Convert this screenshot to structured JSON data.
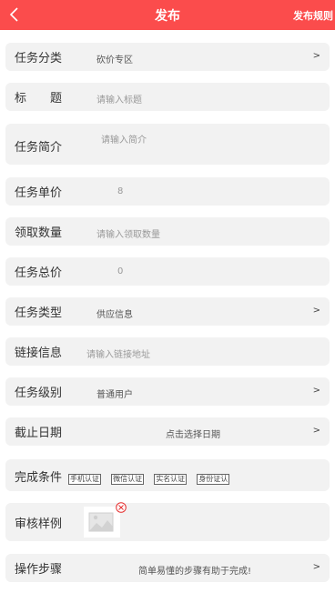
{
  "header": {
    "title": "发布",
    "rules_label": "发布规则"
  },
  "form": {
    "category": {
      "label": "任务分类",
      "value": "砍价专区",
      "arrow": ">"
    },
    "title": {
      "label": "标　　题",
      "placeholder": "请输入标题"
    },
    "intro": {
      "label": "任务简介",
      "placeholder": "请输入简介"
    },
    "unit_price": {
      "label": "任务单价",
      "value": "8"
    },
    "quantity": {
      "label": "领取数量",
      "placeholder": "请输入领取数量"
    },
    "total_price": {
      "label": "任务总价",
      "value": "0"
    },
    "type": {
      "label": "任务类型",
      "value": "供应信息",
      "arrow": ">"
    },
    "link": {
      "label": "链接信息",
      "placeholder": "请输入链接地址"
    },
    "level": {
      "label": "任务级别",
      "value": "普通用户",
      "arrow": ">"
    },
    "deadline": {
      "label": "截止日期",
      "value": "点击选择日期",
      "arrow": ">"
    },
    "conditions": {
      "label": "完成条件",
      "badges": [
        "手机认证",
        "微信认证",
        "实名认证",
        "身份证认"
      ]
    },
    "sample": {
      "label": "审核样例"
    },
    "steps": {
      "label": "操作步骤",
      "value": "简单易懂的步骤有助于完成!",
      "arrow": ">"
    }
  },
  "colors": {
    "header_bg": "#fb4c4c",
    "row_bg": "#f2f2f2"
  }
}
